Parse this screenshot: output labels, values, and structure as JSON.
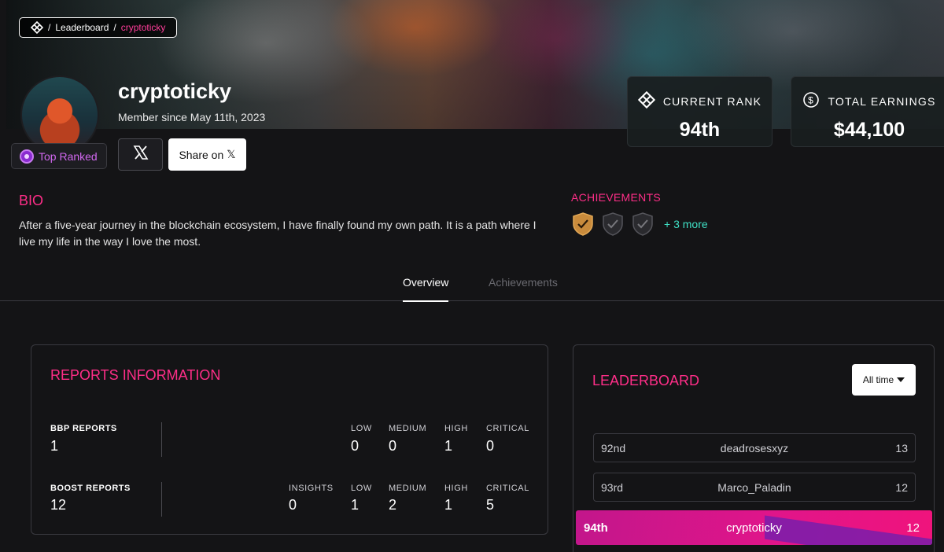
{
  "breadcrumb": {
    "sep1": "/",
    "section": "Leaderboard",
    "sep2": "/",
    "current": "cryptoticky"
  },
  "profile": {
    "username": "cryptoticky",
    "member_since": "Member since May 11th, 2023",
    "top_badge": "Top Ranked",
    "share_label": "Share on",
    "share_glyph": "𝕏"
  },
  "stats": {
    "rank_label": "CURRENT RANK",
    "rank_value": "94th",
    "earnings_label": "TOTAL EARNINGS",
    "earnings_value": "$44,100"
  },
  "bio": {
    "title": "BIO",
    "text": "After a five-year journey in the blockchain ecosystem, I have finally found my own path. It is a path where I live my life in the way I love the most."
  },
  "achievements": {
    "title": "ACHIEVEMENTS",
    "more": "+ 3 more",
    "colors": {
      "earned": "#c98b3c",
      "locked": "#3a3a3e"
    }
  },
  "tabs": {
    "overview": "Overview",
    "achievements": "Achievements"
  },
  "reports": {
    "title": "REPORTS INFORMATION",
    "bbp": {
      "label": "BBP REPORTS",
      "total": "1",
      "low_label": "LOW",
      "low": "0",
      "medium_label": "MEDIUM",
      "medium": "0",
      "high_label": "HIGH",
      "high": "1",
      "critical_label": "CRITICAL",
      "critical": "0"
    },
    "boost": {
      "label": "BOOST REPORTS",
      "total": "12",
      "insights_label": "INSIGHTS",
      "insights": "0",
      "low_label": "LOW",
      "low": "1",
      "medium_label": "MEDIUM",
      "medium": "2",
      "high_label": "HIGH",
      "high": "1",
      "critical_label": "CRITICAL",
      "critical": "5"
    }
  },
  "leaderboard": {
    "title": "LEADERBOARD",
    "filter": "All time",
    "rows": [
      {
        "pos": "92nd",
        "name": "deadrosesxyz",
        "score": "13"
      },
      {
        "pos": "93rd",
        "name": "Marco_Paladin",
        "score": "12"
      },
      {
        "pos": "94th",
        "name": "cryptoticky",
        "score": "12"
      }
    ]
  },
  "colors": {
    "accent": "#ff2e88",
    "teal": "#3fe0c5",
    "purple_badge": "#d268f0"
  }
}
